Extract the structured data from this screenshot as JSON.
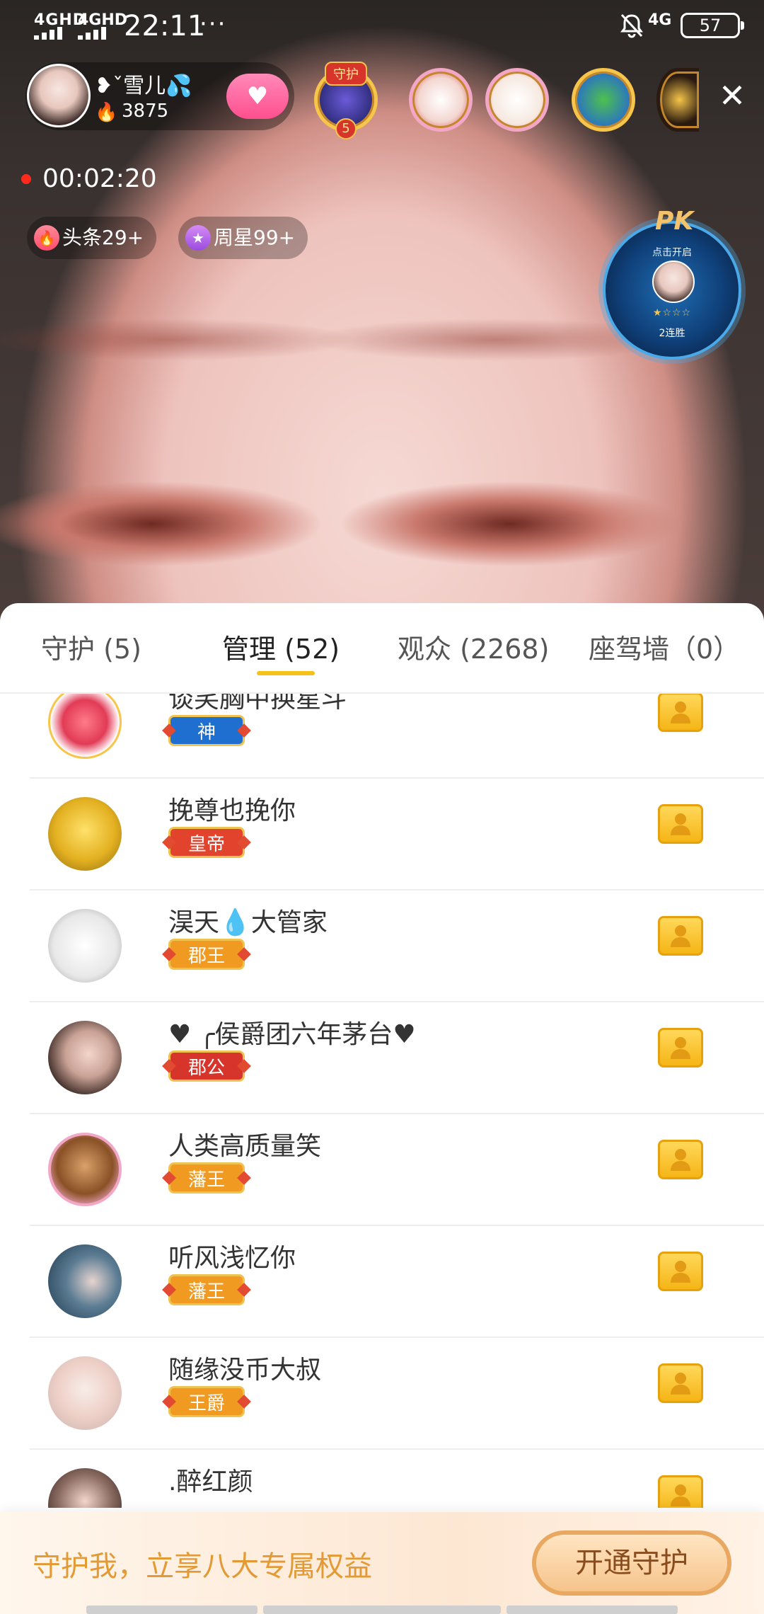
{
  "status_bar": {
    "network1": "4GHD",
    "network2": "4GHD",
    "time": "22:11",
    "dots": "···",
    "network3": "4G",
    "battery": "57"
  },
  "stream": {
    "host_name": "❥ˇ雪儿💦",
    "host_fans": "3875",
    "follow_icon": "heart-icon",
    "guard_badge_label": "守护",
    "guard_badge_num": "5",
    "live_duration": "00:02:20",
    "headline_tag": "头条29+",
    "weekly_star_tag": "周星99+",
    "pk": {
      "title": "PK",
      "start_text": "点击开启",
      "streak": "2连胜",
      "stars": "★☆☆☆"
    }
  },
  "tabs": [
    {
      "label": "守护 (5)"
    },
    {
      "label": "管理 (52)",
      "active": true
    },
    {
      "label": "观众 (2268)"
    },
    {
      "label": "座驾墙（0）"
    }
  ],
  "members": [
    {
      "name": "谈笑胸中换星斗",
      "badge": "神",
      "badge_color": "#1f6fd1"
    },
    {
      "name": "挽尊也挽你",
      "badge": "皇帝",
      "badge_color": "#e2432c"
    },
    {
      "name": "淏天💧大管家",
      "badge": "郡王",
      "badge_color": "#f09a22"
    },
    {
      "name": "♥ ╭侯爵团六年茅台♥",
      "badge": "郡公",
      "badge_color": "#d7342b"
    },
    {
      "name": "人类高质量笑",
      "badge": "藩王",
      "badge_color": "#f09a22"
    },
    {
      "name": "听风浅忆你",
      "badge": "藩王",
      "badge_color": "#f09a22"
    },
    {
      "name": "随缘没币大叔",
      "badge": "王爵",
      "badge_color": "#f09a22"
    },
    {
      "name": ".醉红颜",
      "badge": "",
      "badge_color": "#f09a22"
    }
  ],
  "bottom_bar": {
    "promo": "守护我，立享八大专属权益",
    "button": "开通守护"
  },
  "colors": {
    "accent_yellow": "#f6c21a",
    "promo_orange": "#e39a34",
    "live_red": "#ff2a1c"
  }
}
